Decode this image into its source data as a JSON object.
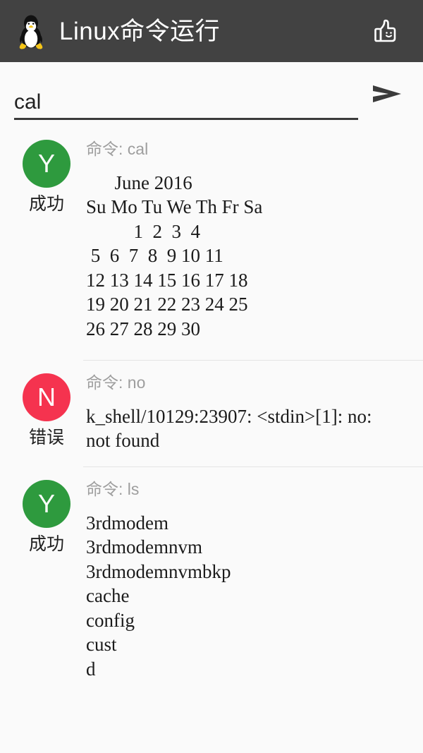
{
  "appbar": {
    "logo_icon": "tux-penguin-logo",
    "title": "Linux命令运行",
    "action_icon": "thumbs-up-icon"
  },
  "input": {
    "value": "cal",
    "placeholder": "",
    "send_icon": "send-arrow-icon"
  },
  "colors": {
    "appbar_bg": "#424242",
    "page_bg": "#fafafa",
    "success": "#2e9a3e",
    "error": "#f5334f",
    "divider": "#e4e4e4",
    "muted_text": "#9e9e9e"
  },
  "labels": {
    "command_prefix": "命令: ",
    "success": "成功",
    "error": "错误",
    "success_glyph": "Y",
    "error_glyph": "N"
  },
  "results": [
    {
      "status": "success",
      "glyph": "Y",
      "status_label": "成功",
      "command_line": "命令: cal",
      "command": "cal",
      "output": "      June 2016\nSu Mo Tu We Th Fr Sa\n          1  2  3  4\n 5  6  7  8  9 10 11\n12 13 14 15 16 17 18\n19 20 21 22 23 24 25\n26 27 28 29 30"
    },
    {
      "status": "error",
      "glyph": "N",
      "status_label": "错误",
      "command_line": "命令: no",
      "command": "no",
      "output": "k_shell/10129:23907: <stdin>[1]: no:\nnot found"
    },
    {
      "status": "success",
      "glyph": "Y",
      "status_label": "成功",
      "command_line": "命令: ls",
      "command": "ls",
      "output": "3rdmodem\n3rdmodemnvm\n3rdmodemnvmbkp\ncache\nconfig\ncust\nd"
    }
  ]
}
